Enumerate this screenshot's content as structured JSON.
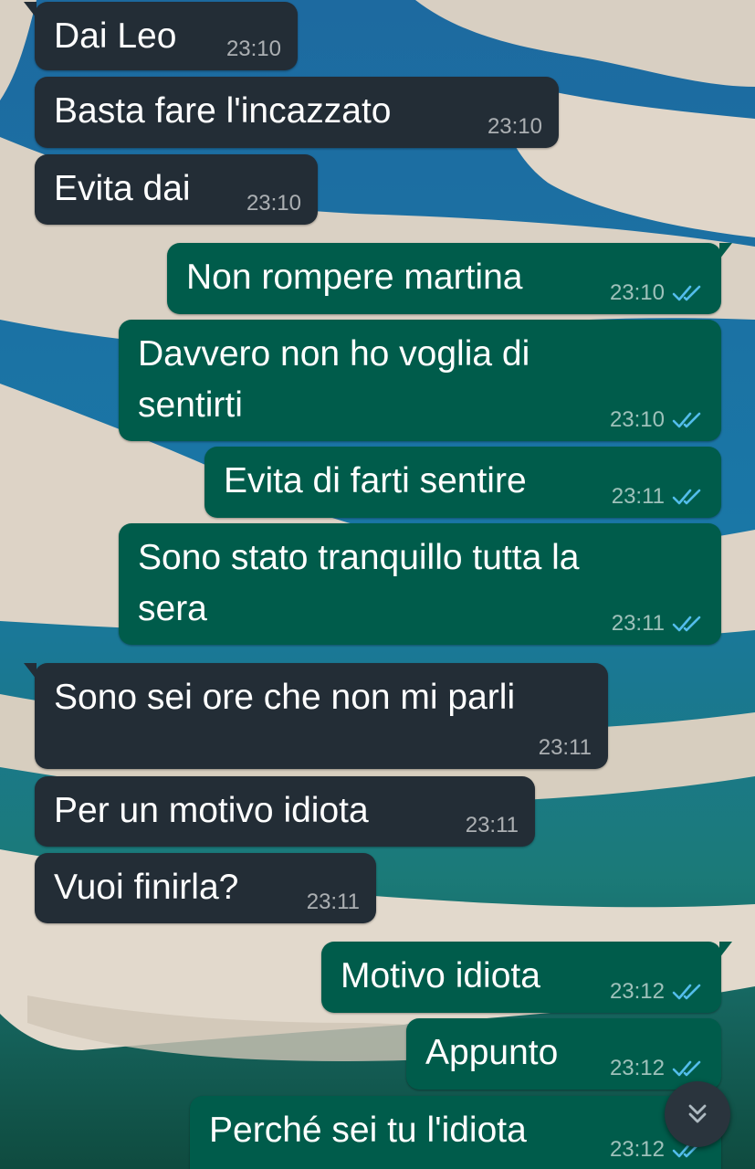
{
  "chat": {
    "messages": [
      {
        "direction": "in",
        "text": "Dai Leo",
        "time": "23:10"
      },
      {
        "direction": "in",
        "text": "Basta fare l'incazzato",
        "time": "23:10"
      },
      {
        "direction": "in",
        "text": "Evita dai",
        "time": "23:10"
      },
      {
        "direction": "out",
        "text": "Non rompere martina",
        "time": "23:10",
        "status": "read"
      },
      {
        "direction": "out",
        "text": "Davvero non ho voglia di",
        "text2": "sentirti",
        "time": "23:10",
        "status": "read"
      },
      {
        "direction": "out",
        "text": "Evita di farti sentire",
        "time": "23:11",
        "status": "read"
      },
      {
        "direction": "out",
        "text": "Sono stato tranquillo tutta la",
        "text2": "sera",
        "time": "23:11",
        "status": "read"
      },
      {
        "direction": "in",
        "text": "Sono sei ore che non mi parli",
        "time": "23:11"
      },
      {
        "direction": "in",
        "text": "Per un motivo idiota",
        "time": "23:11"
      },
      {
        "direction": "in",
        "text": "Vuoi finirla?",
        "time": "23:11"
      },
      {
        "direction": "out",
        "text": "Motivo idiota",
        "time": "23:12",
        "status": "read"
      },
      {
        "direction": "out",
        "text": "Appunto",
        "time": "23:12",
        "status": "read"
      },
      {
        "direction": "out",
        "text": "Perché sei tu l'idiota",
        "time": "23:12",
        "status": "read"
      }
    ]
  },
  "colors": {
    "incoming_bubble": "#232d36",
    "outgoing_bubble": "#005c4b",
    "read_tick": "#53bdeb",
    "timestamp": "#aab3b8"
  },
  "icons": {
    "read_receipt": "double-check-icon",
    "scroll_down": "double-chevron-down-icon"
  }
}
